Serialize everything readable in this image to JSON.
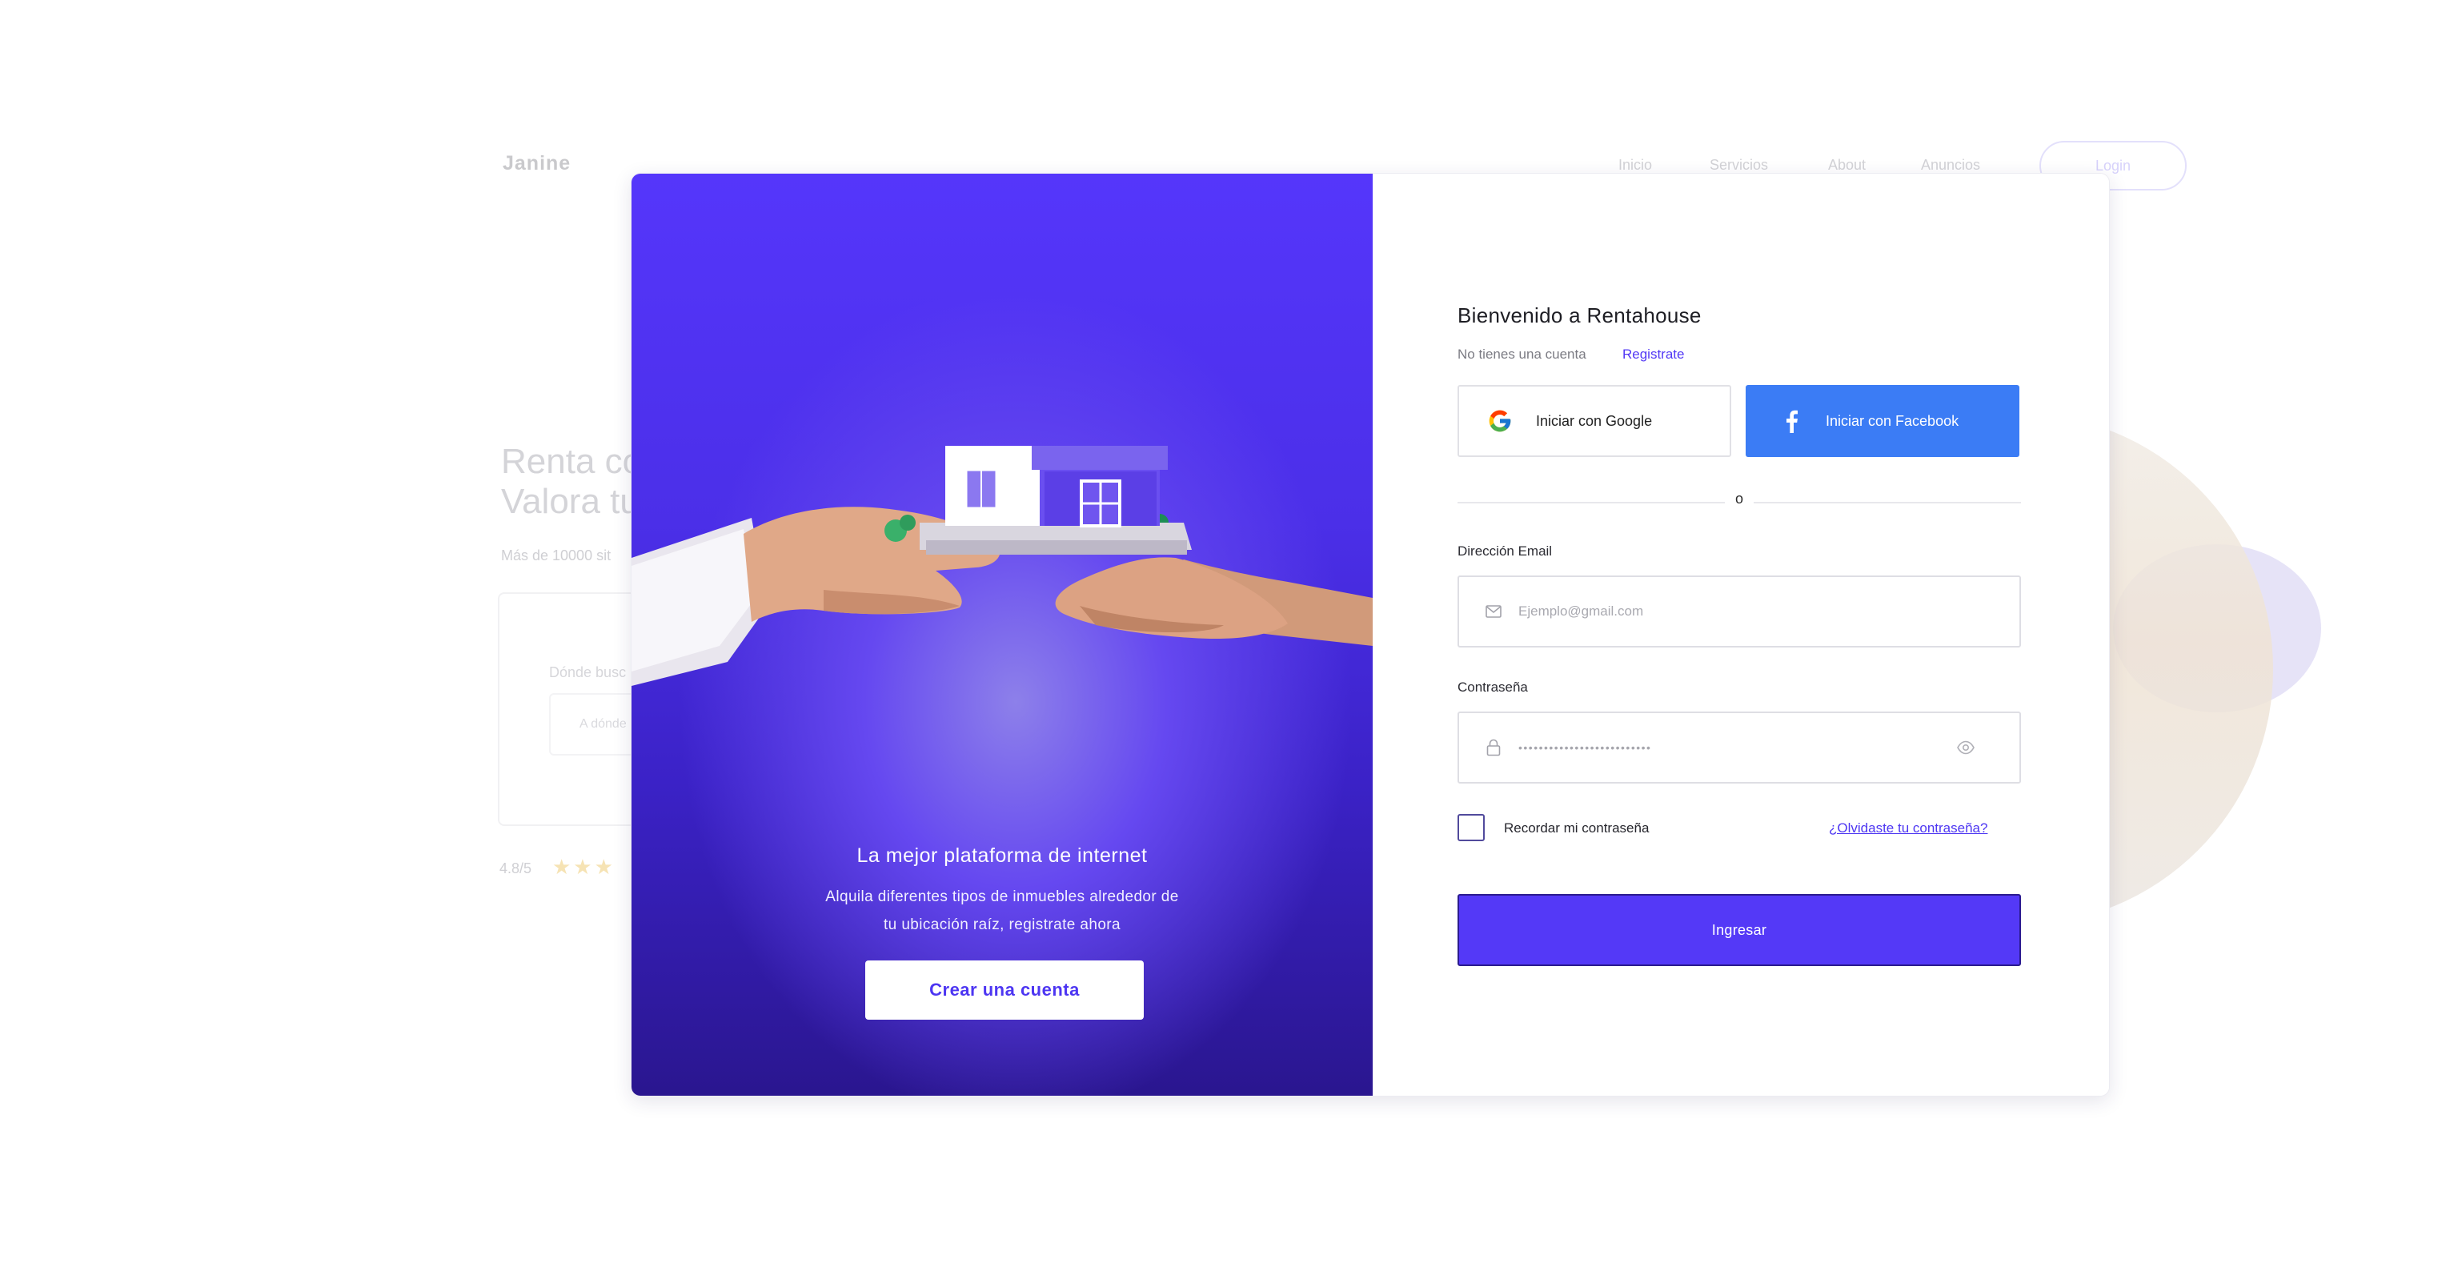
{
  "background_site": {
    "logo": "Janine",
    "nav": [
      "Inicio",
      "Servicios",
      "About",
      "Anuncios"
    ],
    "login_label": "Login",
    "hero_title_line1": "Renta co",
    "hero_title_line2": "Valora tu",
    "hero_subtitle": "Más de 10000 sit",
    "search_label": "Dónde busc",
    "search_placeholder": "A dónde",
    "rating": "4.8/5",
    "stars": "★★★"
  },
  "promo": {
    "title": "La mejor plataforma de internet",
    "text_line1": "Alquila diferentes tipos de inmuebles alrededor de",
    "text_line2": "tu ubicación raíz, registrate ahora",
    "cta_label": "Crear una cuenta"
  },
  "login": {
    "welcome": "Bienvenido a Rentahouse",
    "no_account": "No tienes una cuenta",
    "register_link": "Registrate",
    "google_label": "Iniciar con Google",
    "facebook_label": "Iniciar con Facebook",
    "divider_text": "o",
    "email_label": "Dirección Email",
    "email_placeholder": "Ejemplo@gmail.com",
    "password_label": "Contraseña",
    "password_mask": "••••••••••••••••••••••••••",
    "remember_label": "Recordar mi contraseña",
    "forgot_label": "¿Olvidaste tu contraseña?",
    "submit_label": "Ingresar"
  },
  "icons": {
    "google": "google-icon",
    "facebook": "facebook-icon",
    "email": "mail-icon",
    "password": "lock-icon",
    "show_password": "eye-icon"
  },
  "colors": {
    "accent": "#5439f7",
    "facebook": "#3b7cf5",
    "panel_top": "#5536fb",
    "panel_bottom": "#2a168f"
  }
}
